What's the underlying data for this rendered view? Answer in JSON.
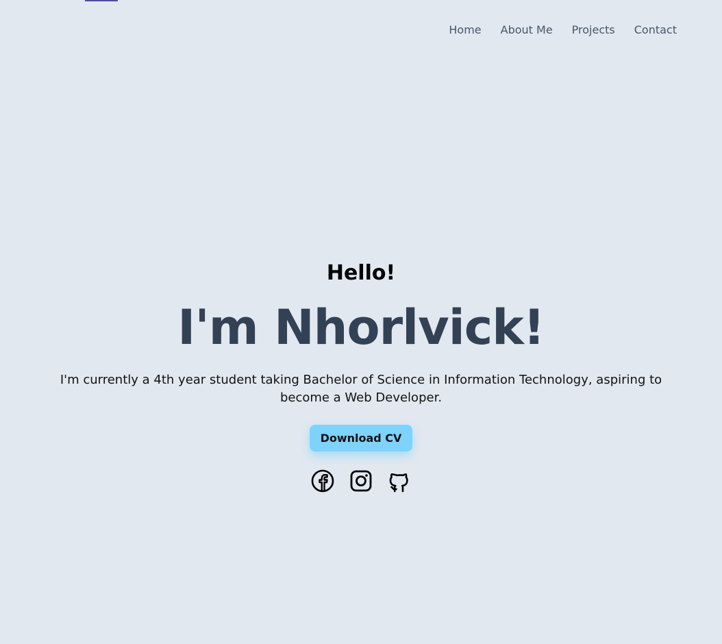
{
  "nav": {
    "items": [
      {
        "label": "Home"
      },
      {
        "label": "About Me"
      },
      {
        "label": "Projects"
      },
      {
        "label": "Contact"
      }
    ]
  },
  "hero": {
    "greeting": "Hello!",
    "name": "I'm Nhorlvick!",
    "bio": "I'm currently a 4th year student taking Bachelor of Science in Information Technology, aspiring to become a Web Developer.",
    "cta_label": "Download CV"
  },
  "socials": [
    {
      "icon": "facebook-icon"
    },
    {
      "icon": "instagram-icon"
    },
    {
      "icon": "github-icon"
    }
  ],
  "colors": {
    "background": "#e2e8f0",
    "accent": "#7dd3fc",
    "heading": "#334155"
  }
}
